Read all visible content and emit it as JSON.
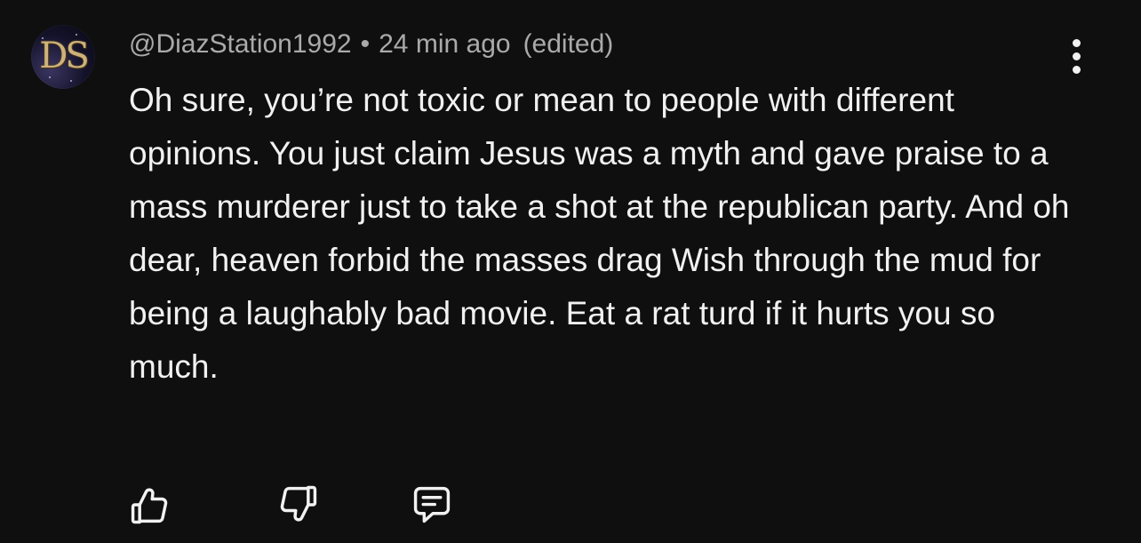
{
  "comment": {
    "avatar": {
      "initials": "DS",
      "icon": "avatar-image"
    },
    "author": "@DiazStation1992",
    "separator": "•",
    "time": "24 min ago",
    "edited": "(edited)",
    "text": "Oh sure, you’re not toxic or mean to people with different opinions. You just claim Jesus was a myth and gave praise to a mass murderer just to take a shot at the republican party. And oh dear, heaven forbid the masses drag Wish through the mud for being a laughably bad movie. Eat a rat turd if it hurts you so much."
  },
  "actions": {
    "like_icon": "thumbs-up-icon",
    "dislike_icon": "thumbs-down-icon",
    "reply_icon": "comment-icon",
    "more_icon": "more-vertical-icon"
  },
  "colors": {
    "background": "#0f0f0f",
    "text": "#f1f1f1",
    "meta": "#aaaaaa"
  }
}
